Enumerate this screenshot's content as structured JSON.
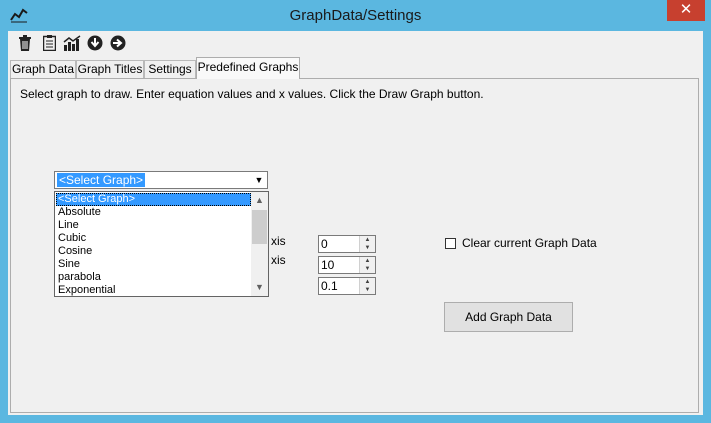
{
  "window": {
    "title": "GraphData/Settings",
    "close_glyph": "✕"
  },
  "toolbar": {
    "icons": [
      "trash-icon",
      "clipboard-icon",
      "chart-icon",
      "download-icon",
      "forward-icon"
    ]
  },
  "tabs": [
    {
      "label": "Graph Data",
      "active": false
    },
    {
      "label": "Graph Titles",
      "active": false
    },
    {
      "label": "Settings",
      "active": false
    },
    {
      "label": "Predefined Graphs",
      "active": true
    }
  ],
  "panel": {
    "instructions": "Select graph to draw. Enter equation values and x values. Click the Draw Graph button.",
    "graph_select": {
      "value": "<Select Graph>",
      "options": [
        "<Select Graph>",
        "Absolute",
        "Line",
        "Cubic",
        "Cosine",
        "Sine",
        "parabola",
        "Exponential"
      ]
    },
    "labels": {
      "x_min_fragment": "xis",
      "x_max_fragment": "xis"
    },
    "spinners": {
      "x_min": "0",
      "x_max": "10",
      "step": "0.1"
    },
    "clear_checkbox": {
      "label": "Clear current Graph Data",
      "checked": false
    },
    "add_button": "Add Graph Data"
  },
  "colors": {
    "frame": "#5bb7e0",
    "close": "#c7402f",
    "selection": "#3399ff"
  }
}
